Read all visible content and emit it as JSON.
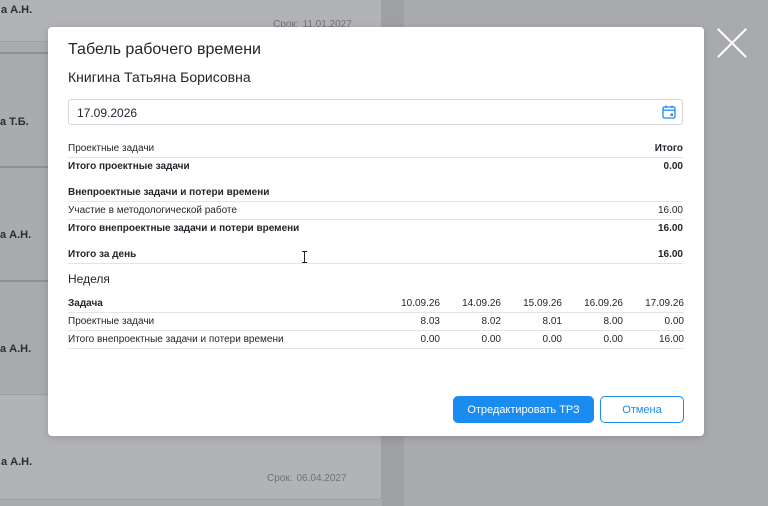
{
  "background": {
    "cards": [
      {
        "name": "а А.Н.",
        "deadline_label": "Срок:",
        "deadline": "11.01.2027"
      },
      {
        "name": "а Т.Б.",
        "deadline_label": "",
        "deadline": ""
      },
      {
        "name": "а А.Н.",
        "deadline_label": "",
        "deadline": ""
      },
      {
        "name": "а А.Н.",
        "deadline_label": "",
        "deadline": ""
      },
      {
        "name": "а А.Н.",
        "deadline_label": "Срок:",
        "deadline": "06.04.2027"
      }
    ]
  },
  "modal": {
    "title": "Табель рабочего времени",
    "person": "Книгина Татьяна Борисовна",
    "date_value": "17.09.2026",
    "summary": {
      "project_header": "Проектные задачи",
      "total_header": "Итого",
      "project_total_label": "Итого проектные задачи",
      "project_total_value": "0.00",
      "nonproject_header": "Внепроектные задачи и потери времени",
      "nonproject_item_label": "Участие в методологической работе",
      "nonproject_item_value": "16.00",
      "nonproject_total_label": "Итого внепроектные задачи и потери времени",
      "nonproject_total_value": "16.00",
      "day_total_label": "Итого за день",
      "day_total_value": "16.00"
    },
    "week": {
      "label": "Неделя",
      "task_header": "Задача",
      "dates": [
        "10.09.26",
        "14.09.26",
        "15.09.26",
        "16.09.26",
        "17.09.26"
      ],
      "rows": [
        {
          "label": "Проектные задачи",
          "values": [
            "8.03",
            "8.02",
            "8.01",
            "8.00",
            "0.00"
          ]
        },
        {
          "label": "Итого внепроектные задачи и потери времени",
          "values": [
            "0.00",
            "0.00",
            "0.00",
            "0.00",
            "16.00"
          ]
        }
      ]
    },
    "buttons": {
      "edit": "Отредактировать ТРЗ",
      "cancel": "Отмена"
    }
  },
  "colors": {
    "accent": "#1a8cf0",
    "overlay": "#a9abaf"
  }
}
